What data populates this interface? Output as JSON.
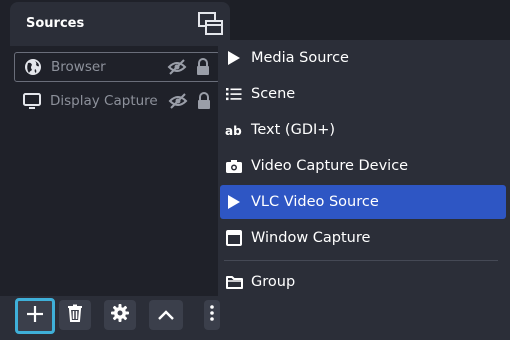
{
  "dock": {
    "title": "Sources",
    "float_icon": "undock-icon"
  },
  "sources": [
    {
      "name": "Browser",
      "icon": "globe-icon",
      "selected": true
    },
    {
      "name": "Display Capture",
      "icon": "monitor-icon",
      "selected": false
    }
  ],
  "toolbar": {
    "buttons": [
      {
        "icon": "plus-icon",
        "name": "add-source-button"
      },
      {
        "icon": "trash-icon",
        "name": "remove-source-button"
      },
      {
        "icon": "gear-icon",
        "name": "source-properties-button"
      },
      {
        "icon": "chevron-up-icon",
        "name": "move-up-button"
      },
      {
        "icon": "more-vertical-icon",
        "name": "more-options-button"
      }
    ]
  },
  "menu": {
    "items": [
      {
        "label": "Media Source",
        "icon": "play-icon"
      },
      {
        "label": "Scene",
        "icon": "list-icon"
      },
      {
        "label": "Text (GDI+)",
        "icon": "text-ab-icon"
      },
      {
        "label": "Video Capture Device",
        "icon": "camera-icon"
      },
      {
        "label": "VLC Video Source",
        "icon": "play-icon",
        "highlighted": true
      },
      {
        "label": "Window Capture",
        "icon": "window-icon"
      },
      {
        "label": "Group",
        "icon": "folder-icon"
      }
    ]
  },
  "colors": {
    "accent": "#2e56c4",
    "focus_ring": "#3fb0d9",
    "panel": "#2b2e38",
    "background": "#1f2129"
  }
}
